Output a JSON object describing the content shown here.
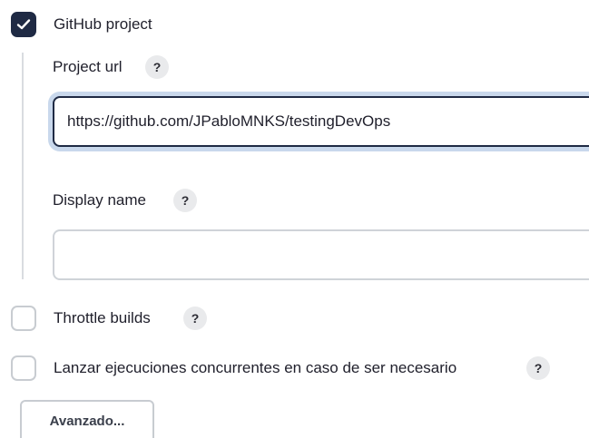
{
  "github_project": {
    "checked": true,
    "label": "GitHub project",
    "project_url": {
      "label": "Project url",
      "help": "?",
      "value": "https://github.com/JPabloMNKS/testingDevOps"
    },
    "display_name": {
      "label": "Display name",
      "help": "?",
      "value": ""
    }
  },
  "throttle_builds": {
    "checked": false,
    "label": "Throttle builds",
    "help": "?"
  },
  "concurrent_builds": {
    "checked": false,
    "label": "Lanzar ejecuciones concurrentes en caso de ser necesario",
    "help": "?"
  },
  "advanced_button": {
    "label": "Avanzado..."
  },
  "colors": {
    "accent": "#1f2a44",
    "focus_ring": "#c9d8ec",
    "border": "#cfd3d8",
    "help_bg": "#e9eaec"
  },
  "icons": {
    "check": "check-icon",
    "help": "help-icon"
  }
}
